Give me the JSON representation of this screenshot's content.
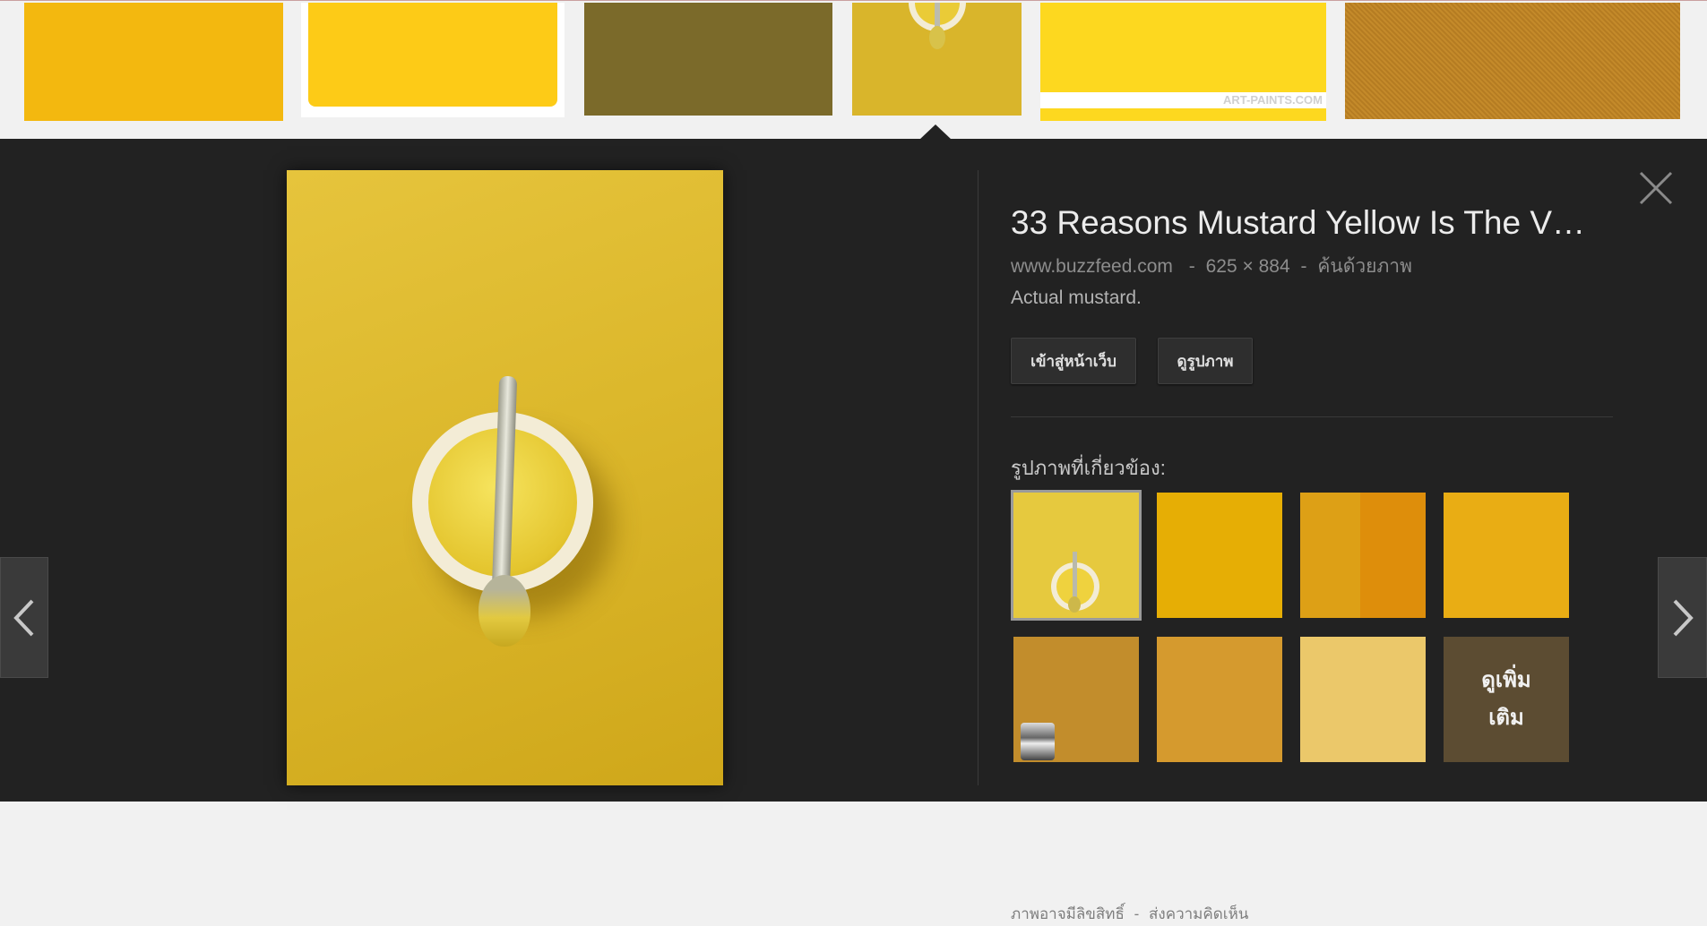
{
  "top_thumbnails": [
    {
      "label": "thumbnail-1",
      "color": "#f3b80f"
    },
    {
      "label": "thumbnail-2",
      "color": "#fdcb17"
    },
    {
      "label": "thumbnail-3",
      "color": "#7b6a2a"
    },
    {
      "label": "thumbnail-4",
      "color": "#d9b52b"
    },
    {
      "label": "thumbnail-5",
      "color": "#fdd81f",
      "watermark": "ART-PAINTS.COM"
    },
    {
      "label": "thumbnail-6",
      "color": "#c48a2a"
    }
  ],
  "detail": {
    "title": "33 Reasons Mustard Yellow Is The V…",
    "source": "www.buzzfeed.com",
    "sep1": "-",
    "dimensions": "625 × 884",
    "sep2": "-",
    "search_by_image": "ค้นด้วยภาพ",
    "description": "Actual mustard.",
    "visit_button": "เข้าสู่หน้าเว็บ",
    "view_button": "ดูรูปภาพ",
    "related_label": "รูปภาพที่เกี่ยวข้อง:",
    "related": [
      {
        "color": "#e6c93e",
        "selected": true
      },
      {
        "color": "#e6ae05"
      },
      {
        "color": "#dda016"
      },
      {
        "color": "#e9ad14"
      },
      {
        "color": "#c28d2c"
      },
      {
        "color": "#d59a2e"
      },
      {
        "color": "#ebc86a"
      }
    ],
    "more_line1": "ดูเพิ่ม",
    "more_line2": "เติม",
    "copyright": "ภาพอาจมีลิขสิทธิ์",
    "footer_sep": "-",
    "feedback": "ส่งความคิดเห็น"
  },
  "icons": {
    "close": "close-icon",
    "prev": "chevron-left-icon",
    "next": "chevron-right-icon"
  }
}
